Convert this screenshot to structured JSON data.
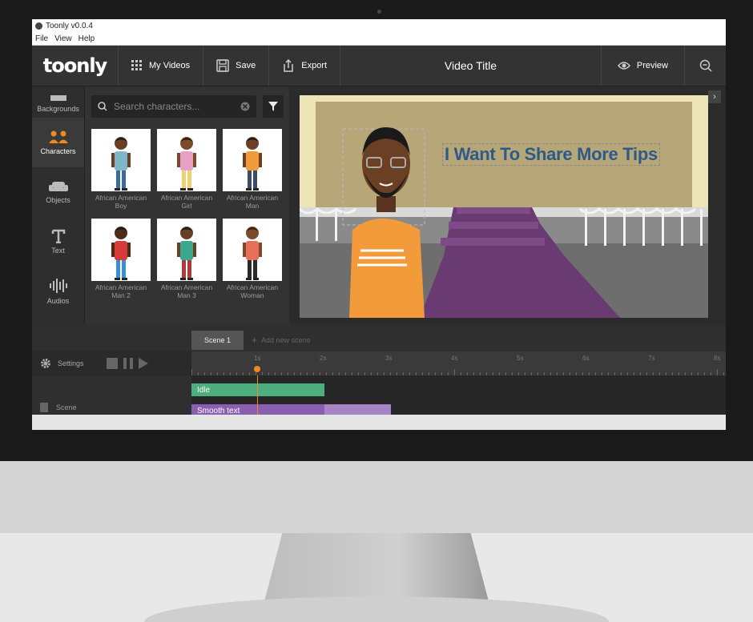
{
  "window": {
    "title": "Toonly v0.0.4"
  },
  "menu": [
    "File",
    "View",
    "Help"
  ],
  "topbar": {
    "logo": "toonly",
    "my_videos": "My Videos",
    "save": "Save",
    "export": "Export",
    "video_title": "Video Title",
    "preview": "Preview"
  },
  "sidebar": {
    "items": [
      {
        "label": "Backgrounds",
        "icon": "backgrounds-icon"
      },
      {
        "label": "Characters",
        "icon": "characters-icon",
        "active": true
      },
      {
        "label": "Objects",
        "icon": "sofa-icon"
      },
      {
        "label": "Text",
        "icon": "text-icon"
      },
      {
        "label": "Audios",
        "icon": "audio-wave-icon"
      }
    ]
  },
  "search": {
    "placeholder": "Search characters..."
  },
  "characters": [
    {
      "label": "African American Boy",
      "shirt": "#7fb6c8",
      "pants": "#3a6aa0",
      "skin": "#6b3f24",
      "hair": "#1a1a1a"
    },
    {
      "label": "African American Girl",
      "shirt": "#e9a0c6",
      "pants": "#f0d070",
      "skin": "#7a4a2a",
      "hair": "#2a1a10"
    },
    {
      "label": "African American Man",
      "shirt": "#f39a3a",
      "pants": "#3c4c6a",
      "skin": "#6b3f24",
      "hair": "#1a1a1a"
    },
    {
      "label": "African American Man 2",
      "shirt": "#d83a3a",
      "pants": "#3a8fd0",
      "skin": "#4a2c18",
      "hair": "#1a1a1a"
    },
    {
      "label": "African American Man 3",
      "shirt": "#3aa88f",
      "pants": "#b03a3a",
      "skin": "#6b3f24",
      "hair": "#1a1a1a"
    },
    {
      "label": "African American Woman",
      "shirt": "#e8705a",
      "pants": "#2a2a2a",
      "skin": "#7a4a2a",
      "hair": "#3a2010"
    }
  ],
  "stage": {
    "headline": "I Want To Share More Tips"
  },
  "timeline": {
    "scene_tab": "Scene 1",
    "add_scene": "Add new scene",
    "settings": "Settings",
    "ticks": [
      "1s",
      "2s",
      "3s",
      "4s",
      "5s",
      "6s",
      "7s",
      "8s"
    ],
    "tracks": {
      "idle": "Idle",
      "text": "Smooth text"
    },
    "scene_label": "Scene"
  },
  "colors": {
    "accent": "#f08a1a",
    "idle": "#4caf7d",
    "text_track": "#8a5fb0"
  }
}
